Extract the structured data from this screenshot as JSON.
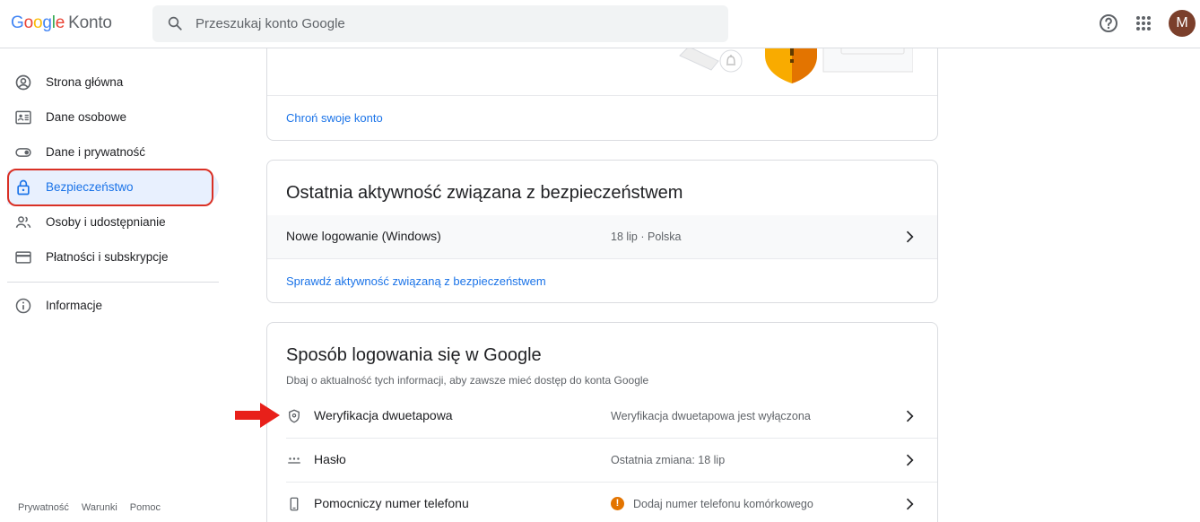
{
  "header": {
    "logo_parts": [
      "G",
      "o",
      "o",
      "g",
      "l",
      "e"
    ],
    "product": "Konto",
    "search_placeholder": "Przeszukaj konto Google",
    "avatar_letter": "M",
    "icons": [
      "search-icon",
      "help-icon",
      "apps-grid-icon"
    ]
  },
  "sidebar": {
    "items": [
      {
        "label": "Strona główna",
        "icon": "account-circle-icon"
      },
      {
        "label": "Dane osobowe",
        "icon": "id-card-icon"
      },
      {
        "label": "Dane i prywatność",
        "icon": "toggle-icon"
      },
      {
        "label": "Bezpieczeństwo",
        "icon": "lock-icon",
        "active": true
      },
      {
        "label": "Osoby i udostępnianie",
        "icon": "people-icon"
      },
      {
        "label": "Płatności i subskrypcje",
        "icon": "credit-card-icon"
      },
      {
        "label": "Informacje",
        "icon": "info-icon"
      }
    ],
    "footer": [
      "Prywatność",
      "Warunki",
      "Pomoc"
    ]
  },
  "card_protect": {
    "link": "Chroń swoje konto"
  },
  "card_activity": {
    "title": "Ostatnia aktywność związana z bezpieczeństwem",
    "row_label": "Nowe logowanie (Windows)",
    "row_value": "18 lip · Polska",
    "link": "Sprawdź aktywność związaną z bezpieczeństwem"
  },
  "card_signin": {
    "title": "Sposób logowania się w Google",
    "subtitle": "Dbaj o aktualność tych informacji, aby zawsze mieć dostęp do konta Google",
    "rows": [
      {
        "label": "Weryfikacja dwuetapowa",
        "value": "Weryfikacja dwuetapowa jest wyłączona",
        "icon": "shield-icon"
      },
      {
        "label": "Hasło",
        "value": "Ostatnia zmiana: 18 lip",
        "icon": "password-dots-icon"
      },
      {
        "label": "Pomocniczy numer telefonu",
        "value": "Dodaj numer telefonu komórkowego",
        "icon": "phone-icon",
        "warning": true
      }
    ]
  },
  "colors": {
    "accent": "#1a73e8",
    "active_bg": "#e8f0fe",
    "annotation_red": "#d93025",
    "warning": "#e37400"
  }
}
